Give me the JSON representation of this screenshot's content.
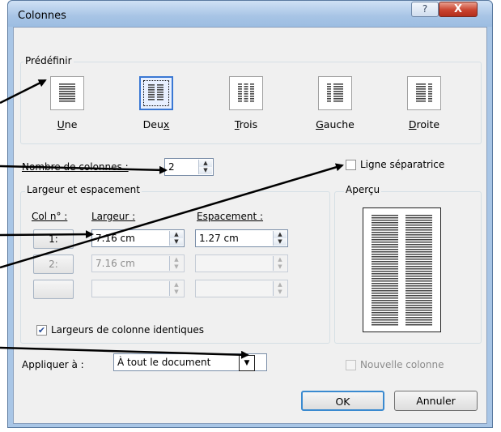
{
  "window": {
    "title": "Colonnes",
    "help_label": "?",
    "close_label": "X"
  },
  "presets": {
    "legend": "Prédéfinir",
    "items": [
      {
        "label": "Une",
        "mnemonic": "U",
        "rest": "ne",
        "selected": false
      },
      {
        "label": "Deux",
        "mnemonic": "x",
        "rest": "Deu",
        "selected": true
      },
      {
        "label": "Trois",
        "mnemonic": "T",
        "rest": "rois",
        "selected": false
      },
      {
        "label": "Gauche",
        "mnemonic": "G",
        "rest": "auche",
        "selected": false
      },
      {
        "label": "Droite",
        "mnemonic": "D",
        "rest": "roite",
        "selected": false
      }
    ]
  },
  "num_columns": {
    "label": "Nombre de colonnes :",
    "value": "2"
  },
  "separator": {
    "label": "Ligne séparatrice",
    "checked": false
  },
  "width_spacing": {
    "legend": "Largeur et espacement",
    "col_header": "Col n° :",
    "width_header": "Largeur :",
    "spacing_header": "Espacement :",
    "rows": [
      {
        "col": "1:",
        "width": "7.16 cm",
        "spacing": "1.27 cm",
        "enabled": true
      },
      {
        "col": "2:",
        "width": "7.16 cm",
        "spacing": "",
        "enabled": false
      },
      {
        "col": "",
        "width": "",
        "spacing": "",
        "enabled": false
      }
    ],
    "equal_widths": {
      "label": "Largeurs de colonne identiques",
      "checked": true
    }
  },
  "preview": {
    "legend": "Aperçu"
  },
  "apply_to": {
    "label": "Appliquer à :",
    "value": "À tout le document"
  },
  "new_column": {
    "label": "Nouvelle colonne",
    "checked": false
  },
  "buttons": {
    "ok": "OK",
    "cancel": "Annuler"
  },
  "colors": {
    "accent": "#3a78d4",
    "arrow": "#000000",
    "title_bar": "#a9c6e6",
    "close": "#c9432f"
  }
}
